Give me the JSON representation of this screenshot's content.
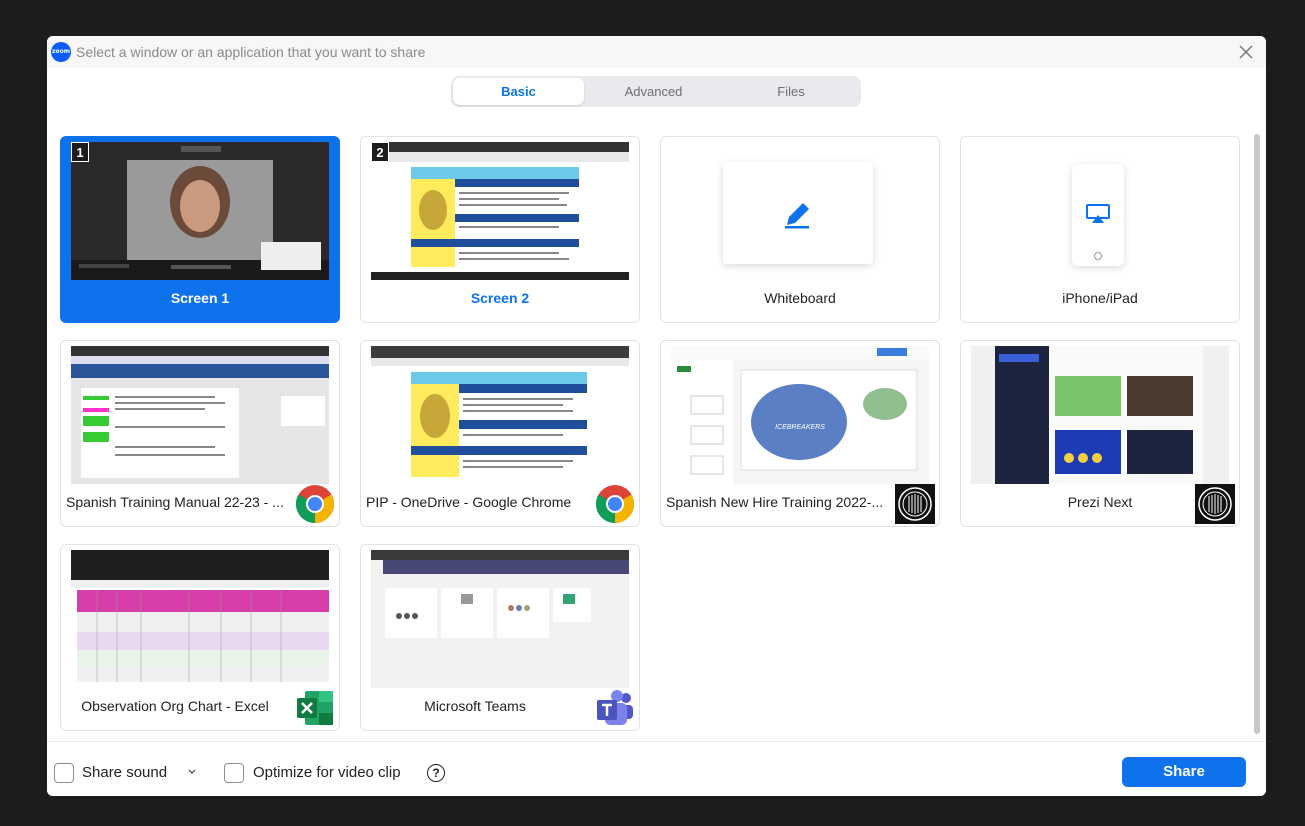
{
  "title_bar": {
    "logo_text": "zoom",
    "title": "Select a window or an application that you want to share"
  },
  "tabs": [
    {
      "label": "Basic",
      "active": true
    },
    {
      "label": "Advanced",
      "active": false
    },
    {
      "label": "Files",
      "active": false
    }
  ],
  "cards": {
    "screen1": {
      "label": "Screen 1",
      "number": "1",
      "selected": true
    },
    "screen2": {
      "label": "Screen 2",
      "number": "2",
      "thumb_heading": "Performance Improvement Plan (PIP)"
    },
    "whiteboard": {
      "label": "Whiteboard",
      "icon": "pencil-icon"
    },
    "iphone": {
      "label": "iPhone/iPad",
      "icon": "airplay-icon"
    },
    "spanish_manual": {
      "label": "Spanish Training Manual 22-23 - ...",
      "app_icon": "chrome-icon"
    },
    "pip": {
      "label": "PIP - OneDrive - Google Chrome",
      "app_icon": "chrome-icon",
      "thumb_heading": "Performance Improvement Plan (PIP)"
    },
    "spanish_hire": {
      "label": "Spanish New Hire Training 2022-...",
      "app_icon": "prezi-icon",
      "thumb_text": "ICEBREAKERS"
    },
    "prezi": {
      "label": "Prezi Next",
      "app_icon": "prezi-icon"
    },
    "org_chart": {
      "label": "Observation Org Chart - Excel",
      "app_icon": "excel-icon"
    },
    "teams": {
      "label": "Microsoft Teams",
      "app_icon": "teams-icon"
    }
  },
  "footer": {
    "share_sound_label": "Share sound",
    "optimize_label": "Optimize for video clip",
    "help_label": "?",
    "share_button_label": "Share"
  },
  "colors": {
    "accent": "#0e72ed",
    "selected_card_bg": "#0e72ed"
  }
}
